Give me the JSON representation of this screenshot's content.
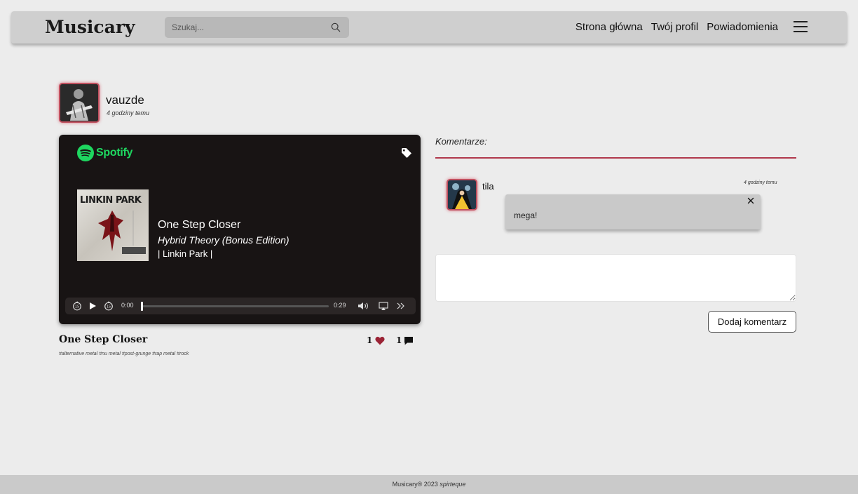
{
  "navbar": {
    "logo": "Musicary",
    "search_placeholder": "Szukaj...",
    "links": [
      "Strona główna",
      "Twój profil",
      "Powiadomienia"
    ]
  },
  "post": {
    "user": "vauzde",
    "time": "4 godziny temu",
    "title": "One Step Closer",
    "likes": "1",
    "comments": "1",
    "hashtags": "#alternative metal #nu metal #post-grunge #rap metal #rock",
    "accent_color": "#9b2335"
  },
  "player": {
    "brand": "Spotify",
    "cover_text": "LINKIN PARK",
    "track": "One Step Closer",
    "album": "Hybrid Theory (Bonus Edition)",
    "artist": "| Linkin Park |",
    "time_current": "0:00",
    "time_total": "0:29",
    "progress": 0
  },
  "comments": {
    "heading": "Komentarze:",
    "items": [
      {
        "user": "tila",
        "time": "4 godziny temu",
        "text": "mega!"
      }
    ],
    "add_button": "Dodaj komentarz"
  },
  "footer": {
    "text": "Musicary® 2023",
    "author": "spirteque"
  }
}
